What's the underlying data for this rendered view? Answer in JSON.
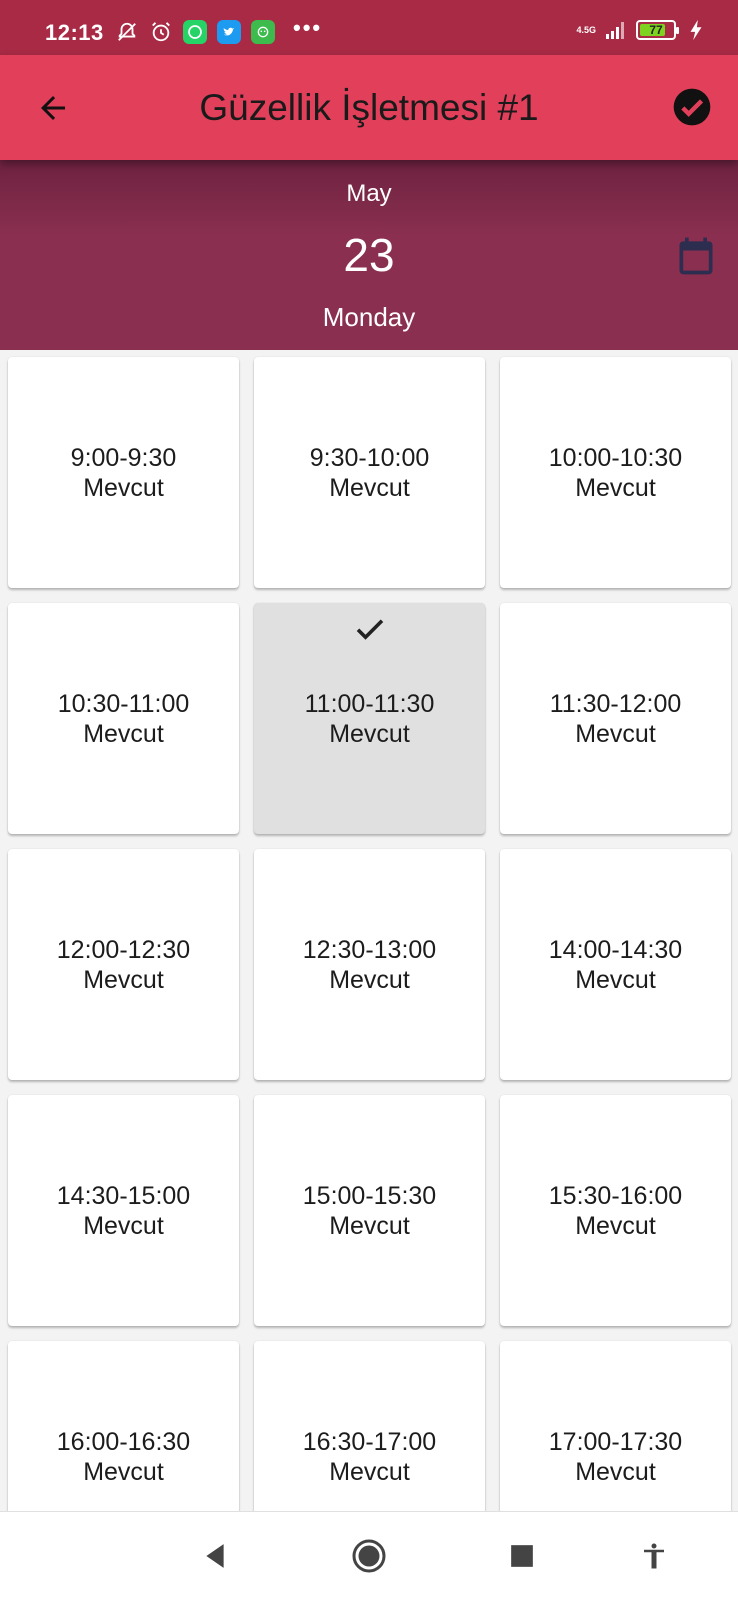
{
  "status_bar": {
    "time": "12:13",
    "network": "4.5G",
    "battery": "77",
    "battery_fill_fraction": 0.77,
    "more": "•••",
    "icons": [
      "notifications-off-icon",
      "alarm-icon",
      "whatsapp-icon",
      "twitter-icon",
      "app-icon",
      "signal-icon",
      "charging-icon"
    ]
  },
  "app_bar": {
    "title": "Güzellik İşletmesi #1",
    "back_icon": "arrow-back-icon",
    "confirm_icon": "check-circle-icon",
    "color": "#e2405a"
  },
  "date_header": {
    "month": "May",
    "day": "23",
    "weekday": "Monday",
    "calendar_icon": "calendar-icon",
    "color": "#8a2f4f"
  },
  "slots": [
    {
      "time": "9:00-9:30",
      "status": "Mevcut",
      "selected": false
    },
    {
      "time": "9:30-10:00",
      "status": "Mevcut",
      "selected": false
    },
    {
      "time": "10:00-10:30",
      "status": "Mevcut",
      "selected": false
    },
    {
      "time": "10:30-11:00",
      "status": "Mevcut",
      "selected": false
    },
    {
      "time": "11:00-11:30",
      "status": "Mevcut",
      "selected": true
    },
    {
      "time": "11:30-12:00",
      "status": "Mevcut",
      "selected": false
    },
    {
      "time": "12:00-12:30",
      "status": "Mevcut",
      "selected": false
    },
    {
      "time": "12:30-13:00",
      "status": "Mevcut",
      "selected": false
    },
    {
      "time": "14:00-14:30",
      "status": "Mevcut",
      "selected": false
    },
    {
      "time": "14:30-15:00",
      "status": "Mevcut",
      "selected": false
    },
    {
      "time": "15:00-15:30",
      "status": "Mevcut",
      "selected": false
    },
    {
      "time": "15:30-16:00",
      "status": "Mevcut",
      "selected": false
    },
    {
      "time": "16:00-16:30",
      "status": "Mevcut",
      "selected": false
    },
    {
      "time": "16:30-17:00",
      "status": "Mevcut",
      "selected": false
    },
    {
      "time": "17:00-17:30",
      "status": "Mevcut",
      "selected": false
    }
  ],
  "nav_bar": {
    "icons": [
      "nav-back-icon",
      "nav-home-icon",
      "nav-recents-icon",
      "accessibility-icon"
    ]
  }
}
